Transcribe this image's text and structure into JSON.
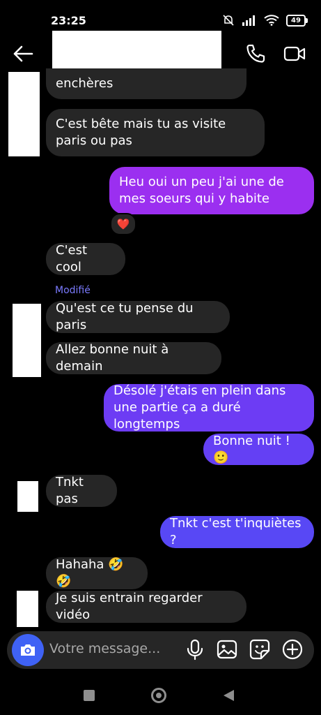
{
  "status_bar": {
    "time": "23:25",
    "battery": "49"
  },
  "header": {
    "contact_name": ""
  },
  "messages": [
    {
      "text": "enchères",
      "dir": "in"
    },
    {
      "text": "C'est bête mais tu as visite paris ou pas",
      "dir": "in"
    },
    {
      "text": "Heu oui un peu j'ai une de mes soeurs qui y habite",
      "dir": "out",
      "reaction": "❤️"
    },
    {
      "text": "C'est cool",
      "dir": "in"
    },
    {
      "text": "Qu'est ce tu pense du paris",
      "dir": "in",
      "label": "Modifié"
    },
    {
      "text": "Allez bonne nuit à demain",
      "dir": "in"
    },
    {
      "text": "Désolé j'étais en plein dans une partie ça a duré longtemps",
      "dir": "out"
    },
    {
      "text": "Bonne nuit ! 🙂",
      "dir": "out"
    },
    {
      "text": "Tnkt pas",
      "dir": "in"
    },
    {
      "text": "Tnkt c'est t'inquiètes ?",
      "dir": "out"
    },
    {
      "text": "Hahaha 🤣🤣",
      "dir": "in"
    },
    {
      "text": "Je suis entrain regarder vidéo",
      "dir": "in"
    }
  ],
  "composer": {
    "placeholder": "Votre message..."
  },
  "colors": {
    "background": "#000000",
    "incoming_bubble": "#262626",
    "outgoing_purple": "#9b2ff0",
    "outgoing_violet": "#6d3cf4",
    "outgoing_blue": "#5848f5",
    "camera_button": "#3f62f5",
    "modified_label": "#7b7bff"
  },
  "icons": [
    "back-arrow-icon",
    "phone-icon",
    "video-camera-icon",
    "camera-icon",
    "microphone-icon",
    "image-icon",
    "sticker-icon",
    "plus-circle-icon",
    "muted-bell-icon",
    "signal-icon",
    "wifi-icon",
    "battery-icon"
  ]
}
